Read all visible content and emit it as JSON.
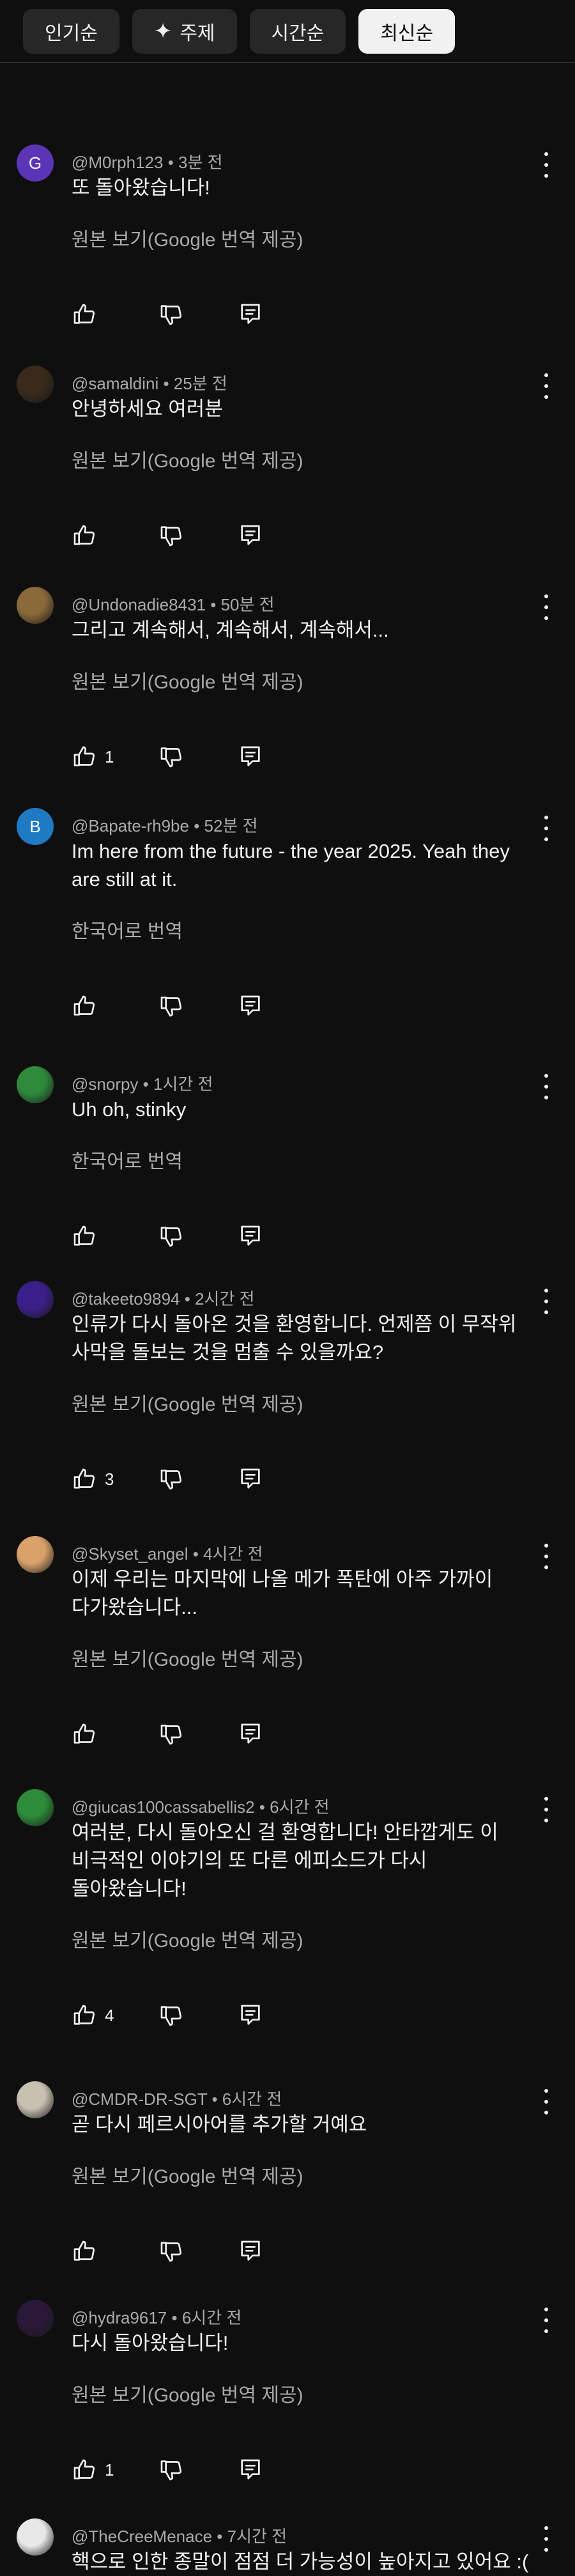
{
  "sort_tabs": [
    {
      "label": "인기순",
      "icon": "",
      "active": false
    },
    {
      "label": "주제",
      "icon": "sparkle-icon",
      "active": false
    },
    {
      "label": "시간순",
      "icon": "",
      "active": false
    },
    {
      "label": "최신순",
      "icon": "",
      "active": true
    }
  ],
  "comments": [
    {
      "author": "@M0rph123",
      "time": "3분 전",
      "text_lines": [
        "또 돌아왔습니다!"
      ],
      "translate_label": "원본 보기(Google 번역 제공)",
      "likes": "",
      "avatar": {
        "type": "letter",
        "letter": "G",
        "color": "#5a35b6"
      }
    },
    {
      "author": "@samaldini",
      "time": "25분 전",
      "text_lines": [
        "안녕하세요 여러분"
      ],
      "translate_label": "원본 보기(Google 번역 제공)",
      "likes": "",
      "avatar": {
        "type": "image",
        "color": "#3a2a1c"
      }
    },
    {
      "author": "@Undonadie8431",
      "time": "50분 전",
      "text_lines": [
        "그리고 계속해서, 계속해서, 계속해서..."
      ],
      "translate_label": "원본 보기(Google 번역 제공)",
      "likes": "1",
      "avatar": {
        "type": "image",
        "color": "#8a6a3a"
      }
    },
    {
      "author": "@Bapate-rh9be",
      "time": "52분 전",
      "text_lines": [
        "Im here from the future - the year 2025. Yeah they",
        "are still at it."
      ],
      "translate_label": "한국어로 번역",
      "likes": "",
      "avatar": {
        "type": "letter",
        "letter": "B",
        "color": "#1f7ac4"
      }
    },
    {
      "author": "@snorpy",
      "time": "1시간 전",
      "text_lines": [
        "Uh oh, stinky"
      ],
      "translate_label": "한국어로 번역",
      "likes": "",
      "avatar": {
        "type": "image",
        "color": "#2f8a3c"
      }
    },
    {
      "author": "@takeeto9894",
      "time": "2시간 전",
      "text_lines": [
        "인류가 다시 돌아온 것을 환영합니다. 언제쯤 이 무작위",
        "사막을 돌보는 것을 멈출 수 있을까요?"
      ],
      "translate_label": "원본 보기(Google 번역 제공)",
      "likes": "3",
      "avatar": {
        "type": "image",
        "color": "#3a1f8a"
      }
    },
    {
      "author": "@Skyset_angel",
      "time": "4시간 전",
      "text_lines": [
        "이제 우리는 마지막에 나올 메가 폭탄에 아주 가까이",
        "다가왔습니다..."
      ],
      "translate_label": "원본 보기(Google 번역 제공)",
      "likes": "",
      "avatar": {
        "type": "image",
        "color": "#d9a26a"
      }
    },
    {
      "author": "@giucas100cassabellis2",
      "time": "6시간 전",
      "text_lines": [
        "여러분, 다시 돌아오신 걸 환영합니다! 안타깝게도 이",
        "비극적인 이야기의 또 다른 에피소드가 다시",
        "돌아왔습니다!"
      ],
      "translate_label": "원본 보기(Google 번역 제공)",
      "likes": "4",
      "avatar": {
        "type": "image",
        "color": "#2e8b3a"
      }
    },
    {
      "author": "@CMDR-DR-SGT",
      "time": "6시간 전",
      "text_lines": [
        "곧 다시 페르시아어를 추가할 거예요"
      ],
      "translate_label": "원본 보기(Google 번역 제공)",
      "likes": "",
      "avatar": {
        "type": "image",
        "color": "#c8c0b0"
      }
    },
    {
      "author": "@hydra9617",
      "time": "6시간 전",
      "text_lines": [
        "다시 돌아왔습니다!"
      ],
      "translate_label": "원본 보기(Google 번역 제공)",
      "likes": "1",
      "avatar": {
        "type": "image",
        "color": "#2a1838"
      }
    },
    {
      "author": "@TheCreeMenace",
      "time": "7시간 전",
      "text_lines": [
        "핵으로 인한 종말이 점점 더 가능성이 높아지고 있어요 :("
      ],
      "translate_label": "",
      "likes": "",
      "avatar": {
        "type": "image",
        "color": "#e8e8e8"
      }
    }
  ]
}
